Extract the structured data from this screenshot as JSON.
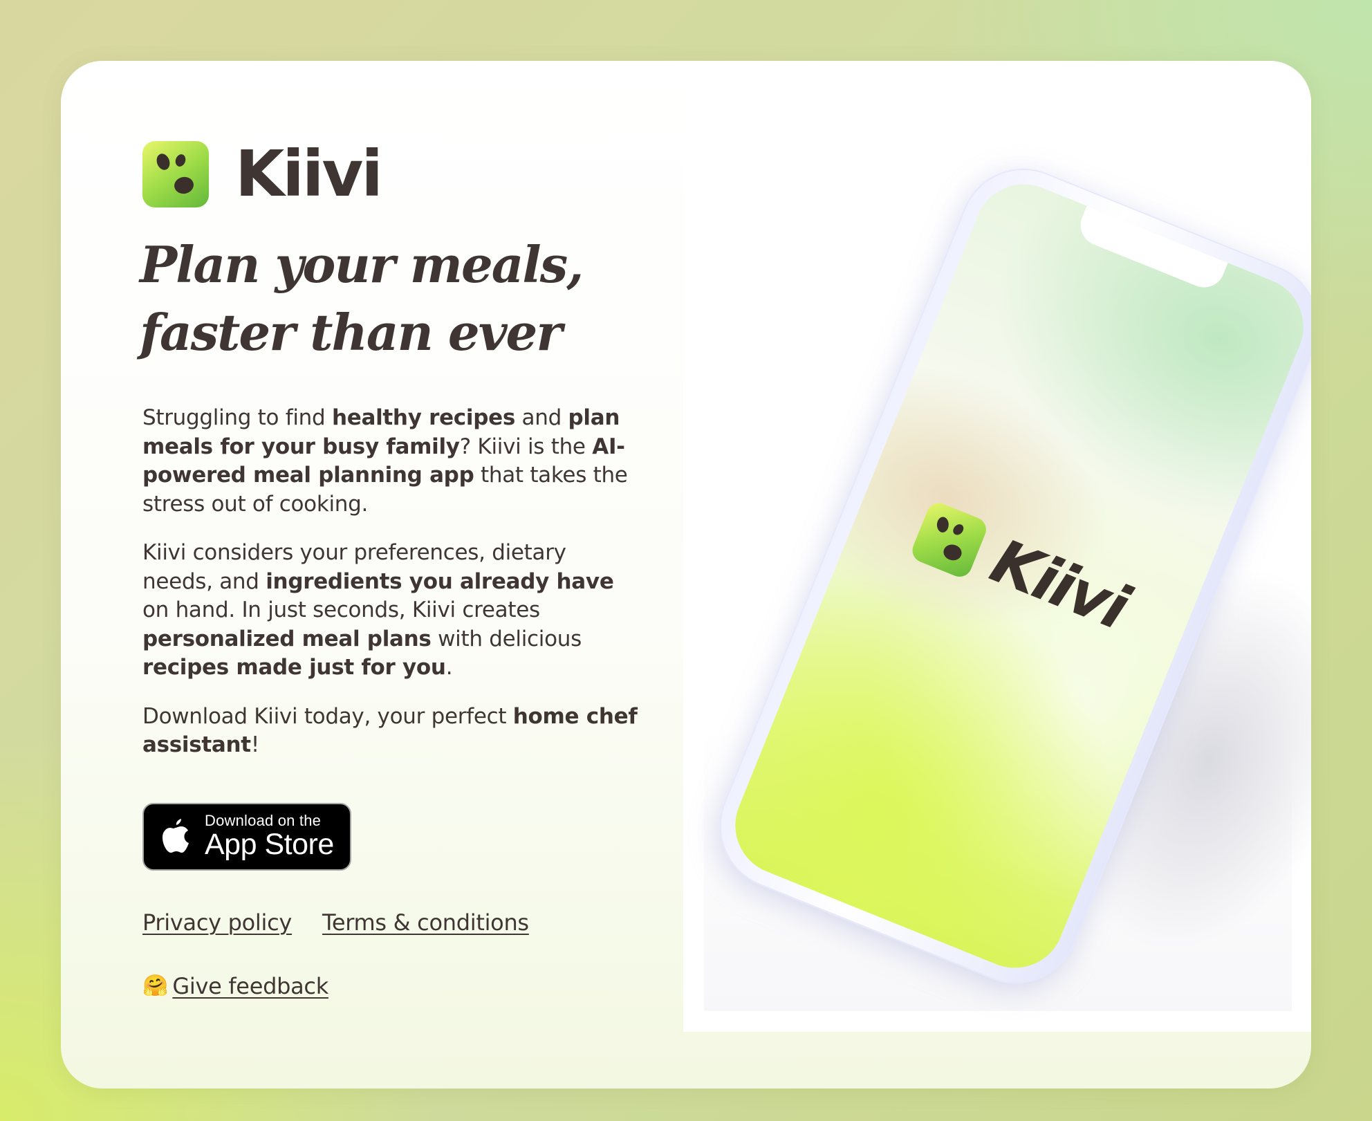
{
  "brand": {
    "name": "Kiivi",
    "logo_icon": "kiivi-seeds-icon",
    "colors": {
      "text": "#3f3633",
      "logo_light": "#e9f66a",
      "logo_dark": "#63b83b"
    }
  },
  "hero": {
    "headline_line1": "Plan your meals,",
    "headline_line2": "faster than ever"
  },
  "intro": {
    "p1": {
      "t1": "Struggling to find ",
      "b1": "healthy recipes",
      "t2": " and ",
      "b2": "plan meals for your busy family",
      "t3": "? Kiivi is the ",
      "b3": "AI-powered meal planning app",
      "t4": " that takes the stress out of cooking."
    },
    "p2": {
      "t1": "Kiivi considers your preferences, dietary needs, and ",
      "b1": "ingredients you already have",
      "t2": " on hand. In just seconds, Kiivi creates ",
      "b2": "personalized meal plans",
      "t3": " with delicious ",
      "b3": "recipes made just for you",
      "t4": "."
    },
    "p3": {
      "t1": "Download Kiivi today, your perfect ",
      "b1": "home chef assistant",
      "t2": "!"
    }
  },
  "app_store": {
    "icon": "apple-icon",
    "small_label": "Download on the",
    "big_label": "App Store"
  },
  "footer": {
    "privacy": "Privacy policy",
    "terms": "Terms & conditions",
    "feedback_emoji": "🤗",
    "feedback": "Give feedback"
  },
  "mockup": {
    "screen_brand": "Kiivi"
  }
}
